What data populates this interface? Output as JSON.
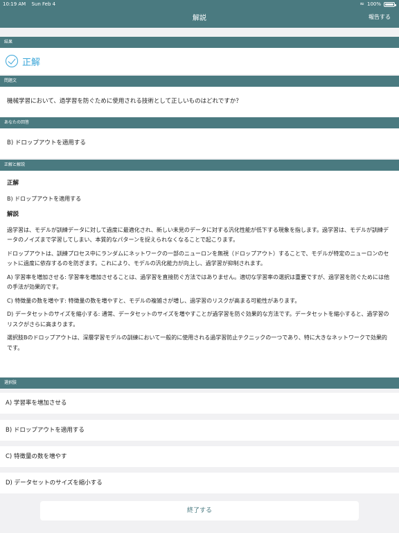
{
  "status_bar": {
    "time": "10:19 AM",
    "date": "Sun Feb 4",
    "battery": "100%"
  },
  "header": {
    "title": "解説",
    "report_label": "報告する"
  },
  "result": {
    "section_label": "結果",
    "text": "正解"
  },
  "question": {
    "section_label": "問題文",
    "text": "機械学習において、過学習を防ぐために使用される技術として正しいものはどれですか？"
  },
  "your_answer": {
    "section_label": "あなたの回答",
    "text": "B) ドロップアウトを適用する"
  },
  "explanation": {
    "section_label": "正解と解説",
    "correct_heading": "正解",
    "correct_answer": "B) ドロップアウトを適用する",
    "explanation_heading": "解説",
    "paragraphs": [
      "過学習は、モデルが訓練データに対して過度に最適化され、新しい未見のデータに対する汎化性能が低下する現象を指します。過学習は、モデルが訓練データのノイズまで学習してしまい、本質的なパターンを捉えられなくなることで起こります。",
      "ドロップアウトは、訓練プロセス中にランダムにネットワークの一部のニューロンを無視（ドロップアウト）することで、モデルが特定のニューロンのセットに過度に依存するのを防ぎます。これにより、モデルの汎化能力が向上し、過学習が抑制されます。",
      "A) 学習率を増加させる: 学習率を増加させることは、過学習を直接防ぐ方法ではありません。適切な学習率の選択は重要ですが、過学習を防ぐためには他の手法が効果的です。",
      "C) 特徴量の数を増やす: 特徴量の数を増やすと、モデルの複雑さが増し、過学習のリスクが高まる可能性があります。",
      "D) データセットのサイズを縮小する: 通常、データセットのサイズを増やすことが過学習を防ぐ効果的な方法です。データセットを縮小すると、過学習のリスクがさらに高まります。",
      "選択肢Bのドロップアウトは、深層学習モデルの訓練において一般的に使用される過学習防止テクニックの一つであり、特に大きなネットワークで効果的です。"
    ]
  },
  "choices": {
    "section_label": "選択肢",
    "items": [
      "A) 学習率を増加させる",
      "B) ドロップアウトを適用する",
      "C) 特徴量の数を増やす",
      "D) データセットのサイズを縮小する"
    ]
  },
  "finish_label": "終了する",
  "colors": {
    "header": "#4a7a80",
    "accent": "#3aa5d8",
    "background": "#f1f1f3"
  }
}
